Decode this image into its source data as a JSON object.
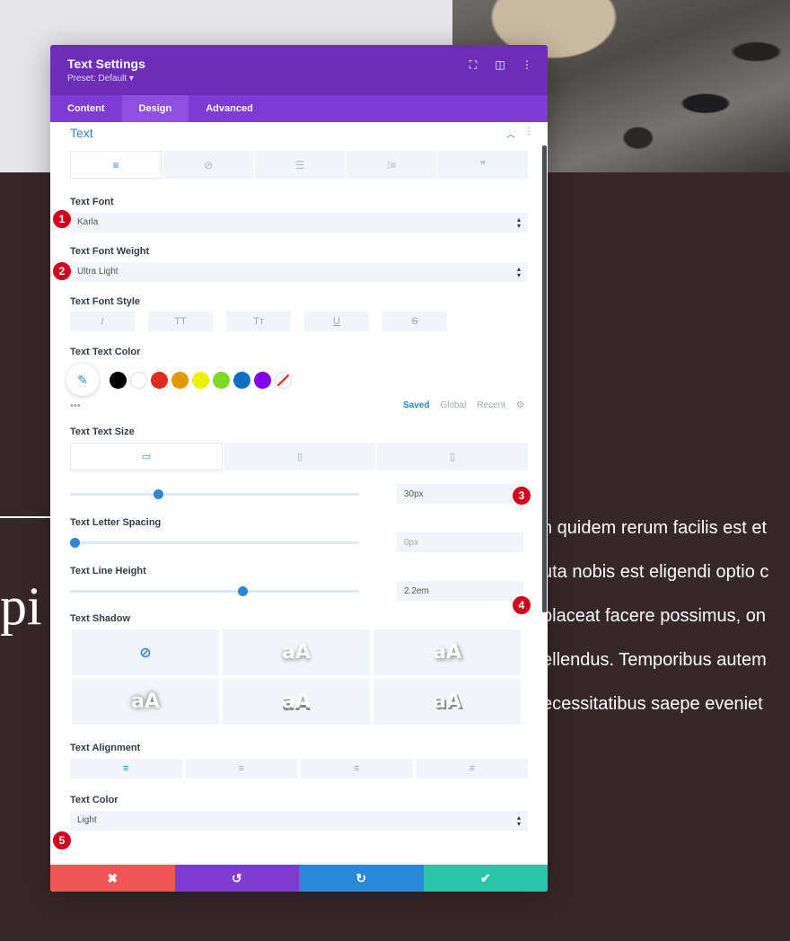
{
  "background": {
    "heading_fragment": "pi",
    "body_lines": [
      "n quidem rerum facilis est et",
      "uta nobis est eligendi optio c",
      "placeat facere possimus, on",
      "ellendus. Temporibus autem",
      "ecessitatibus saepe eveniet"
    ]
  },
  "modal": {
    "title": "Text Settings",
    "preset": "Preset: Default ▾",
    "header_icons": [
      "focus-icon",
      "columns-icon",
      "more-icon"
    ],
    "tabs": [
      {
        "label": "Content",
        "active": false
      },
      {
        "label": "Design",
        "active": true
      },
      {
        "label": "Advanced",
        "active": false
      }
    ],
    "section_title": "Text",
    "subtab_icons": [
      "align-left-icon",
      "link-icon",
      "bullet-list-icon",
      "number-list-icon",
      "quote-icon"
    ],
    "text_font": {
      "label": "Text Font",
      "value": "Karla",
      "marker": "1"
    },
    "text_font_weight": {
      "label": "Text Font Weight",
      "value": "Ultra Light",
      "marker": "2"
    },
    "text_font_style": {
      "label": "Text Font Style",
      "buttons": [
        "I",
        "TT",
        "Tт",
        "U",
        "S"
      ]
    },
    "text_text_color": {
      "label": "Text Text Color",
      "swatches": [
        "#000000",
        "#ffffff",
        "#e02b20",
        "#e09900",
        "#edf000",
        "#7cda24",
        "#0c71c3",
        "#8300e9"
      ],
      "more": "•••",
      "tabs": [
        "Saved",
        "Global",
        "Recent"
      ]
    },
    "text_text_size": {
      "label": "Text Text Size",
      "value": "30px",
      "slider_fraction": 0.3,
      "marker": "3"
    },
    "text_letter_spacing": {
      "label": "Text Letter Spacing",
      "value": "0px",
      "slider_fraction": 0.0
    },
    "text_line_height": {
      "label": "Text Line Height",
      "value": "2.2em",
      "slider_fraction": 0.6,
      "marker": "4"
    },
    "text_shadow": {
      "label": "Text Shadow",
      "preview": "aA"
    },
    "text_alignment": {
      "label": "Text Alignment"
    },
    "text_color": {
      "label": "Text Color",
      "value": "Light",
      "marker": "5"
    },
    "footer": {
      "colors": {
        "cancel": "#ef5555",
        "undo": "#7e3bd0",
        "redo": "#2b87da",
        "save": "#29c4a9"
      }
    }
  }
}
